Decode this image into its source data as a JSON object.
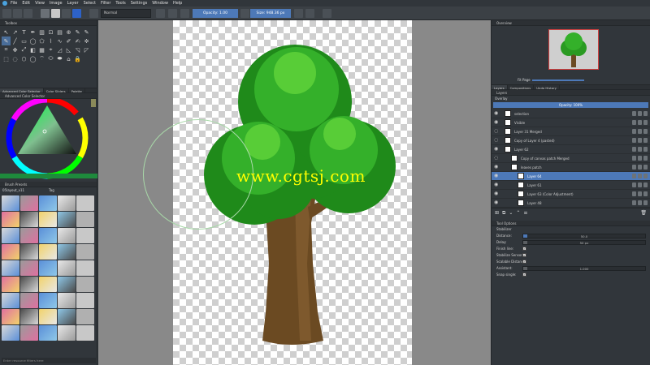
{
  "menubar": {
    "items": [
      "File",
      "Edit",
      "View",
      "Image",
      "Layer",
      "Select",
      "Filter",
      "Tools",
      "Settings",
      "Window",
      "Help"
    ]
  },
  "tool_options": {
    "blend_mode": "Normal",
    "opacity_label": "Opacity: 1.00",
    "size_label": "Size: 948.36 px"
  },
  "left_panel": {
    "toolbox_title": "Toolbox",
    "color_tabs": [
      "Advanced Color Selector",
      "Color Sliders",
      "Palette"
    ],
    "color_title": "Advanced Color Selector",
    "brush_title": "Brush Presets",
    "brush_filter": "05layout_v11",
    "brush_tag": "Tag",
    "brush_search_placeholder": "Enter resource filters here"
  },
  "canvas": {
    "watermark": "www.cgtsj.com"
  },
  "right_panel": {
    "overview_title": "Overview",
    "fit_page_label": "Fit Page",
    "tabs": [
      "Layers",
      "Compositions",
      "Undo History"
    ],
    "layers_title": "Layers",
    "blend_mode": "Overlay",
    "opacity_label": "Opacity: 100%",
    "layers": [
      {
        "name": "selection",
        "indent": 0,
        "visible": true,
        "selected": false
      },
      {
        "name": "Visible",
        "indent": 0,
        "visible": true,
        "selected": false
      },
      {
        "name": "Layer 31 Merged",
        "indent": 0,
        "visible": false,
        "selected": false
      },
      {
        "name": "Copy of Layer 4 (pasted)",
        "indent": 0,
        "visible": false,
        "selected": false
      },
      {
        "name": "Layer 62",
        "indent": 0,
        "visible": true,
        "selected": false
      },
      {
        "name": "Copy of canvas patch Merged",
        "indent": 1,
        "visible": false,
        "selected": false
      },
      {
        "name": "leaves patch",
        "indent": 1,
        "visible": true,
        "selected": false
      },
      {
        "name": "Layer 64",
        "indent": 2,
        "visible": true,
        "selected": true
      },
      {
        "name": "Layer 61",
        "indent": 2,
        "visible": true,
        "selected": false
      },
      {
        "name": "Layer 63 (Color Adjustment)",
        "indent": 2,
        "visible": true,
        "selected": false
      },
      {
        "name": "Layer 48",
        "indent": 2,
        "visible": true,
        "selected": false
      }
    ],
    "tool_options_title": "Tool Options",
    "stabilizer_label": "Stabilizer",
    "distance_label": "Distance:",
    "distance_value": "50.0",
    "delay_label": "Delay:",
    "delay_value": "50 px",
    "finish_line_label": "Finish line:",
    "stabilize_sensors_label": "Stabilize Sensors:",
    "scalable_distance_label": "Scalable Distance:",
    "assistant_label": "Assistant:",
    "assistant_value": "1.000",
    "snap_single_label": "Snap single:"
  },
  "colors": {
    "accent": "#4d79b8",
    "panel_bg": "#31363b",
    "canvas_bg": "#898989"
  }
}
